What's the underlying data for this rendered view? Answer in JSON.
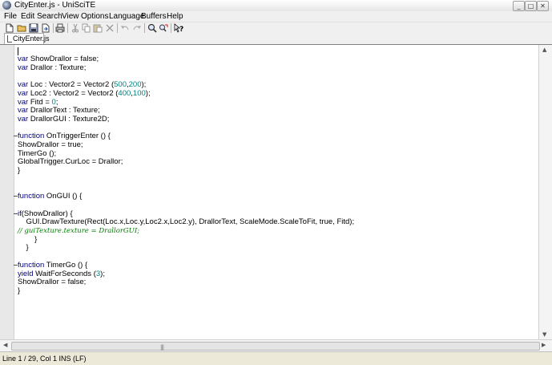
{
  "window": {
    "title": "CityEnter.js - UniSciTE",
    "min_glyph": "_",
    "max_glyph": "□",
    "close_glyph": "✕"
  },
  "menu": [
    "File",
    "Edit",
    "Search",
    "View",
    "Options",
    "Language",
    "Buffers",
    "Help"
  ],
  "toolbar": {
    "icons": [
      "new-file-icon",
      "open-folder-icon",
      "save-icon",
      "save-as-icon",
      "print-icon",
      "cut-icon",
      "copy-icon",
      "paste-icon",
      "delete-icon",
      "undo-icon",
      "redo-icon",
      "find-icon",
      "replace-icon",
      "help-icon"
    ]
  },
  "tabs": [
    {
      "label": "CityEnter.js",
      "active": true
    }
  ],
  "editor": {
    "lines": [
      {
        "fold": "",
        "text": "var ShowDrallor = false;"
      },
      {
        "fold": "",
        "text": "var Drallor : Texture;"
      },
      {
        "fold": "",
        "text": ""
      },
      {
        "fold": "",
        "text": "var Loc : Vector2 = Vector2 (500,200);"
      },
      {
        "fold": "",
        "text": "var Loc2 : Vector2 = Vector2 (400,100);"
      },
      {
        "fold": "",
        "text": "var Fitd = 0;"
      },
      {
        "fold": "",
        "text": "var DrallorText : Texture;"
      },
      {
        "fold": "",
        "text": "var DrallorGUI : Texture2D;"
      },
      {
        "fold": "",
        "text": ""
      },
      {
        "fold": "−",
        "text": "function OnTriggerEnter () {"
      },
      {
        "fold": "",
        "text": "ShowDrallor = true;"
      },
      {
        "fold": "",
        "text": "TimerGo ();"
      },
      {
        "fold": "",
        "text": "GlobalTrigger.CurLoc = Drallor;"
      },
      {
        "fold": "",
        "text": "}"
      },
      {
        "fold": "",
        "text": ""
      },
      {
        "fold": "",
        "text": ""
      },
      {
        "fold": "−",
        "text": "function OnGUI () {"
      },
      {
        "fold": "",
        "text": ""
      },
      {
        "fold": "−",
        "text": "if(ShowDrallor) {"
      },
      {
        "fold": "",
        "text": "    GUI.DrawTexture(Rect(Loc.x,Loc.y,Loc2.x,Loc2.y), DrallorText, ScaleMode.ScaleToFit, true, Fitd);"
      },
      {
        "fold": "",
        "text": "// guiTexture.texture = DrallorGUI;"
      },
      {
        "fold": "",
        "text": "        }"
      },
      {
        "fold": "",
        "text": "    }"
      },
      {
        "fold": "",
        "text": ""
      },
      {
        "fold": "−",
        "text": "function TimerGo () {"
      },
      {
        "fold": "",
        "text": "yield WaitForSeconds (3);"
      },
      {
        "fold": "",
        "text": "ShowDrallor = false;"
      },
      {
        "fold": "",
        "text": "}"
      }
    ]
  },
  "status": {
    "text": "Line 1 / 29, Col 1 INS (LF)"
  }
}
